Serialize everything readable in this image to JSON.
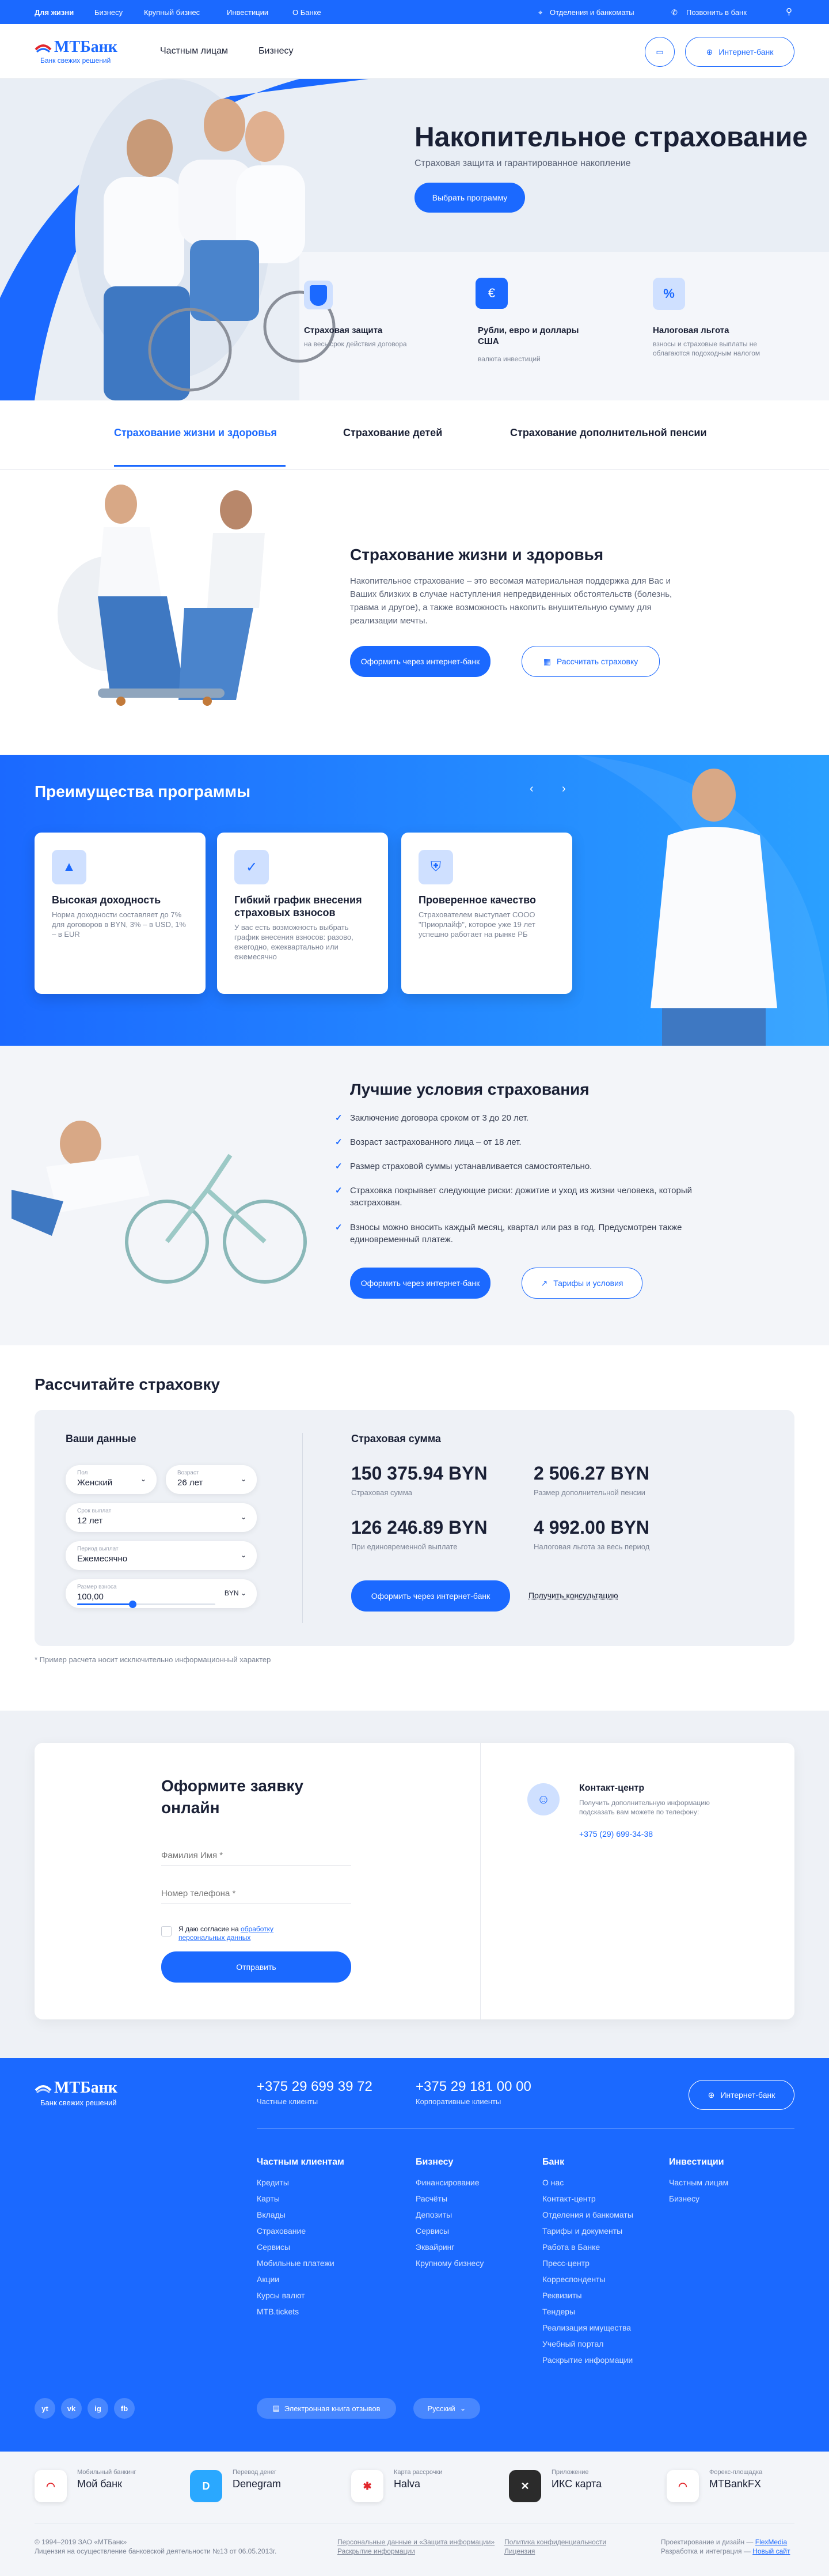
{
  "topbar": {
    "nav": [
      "Для жизни",
      "Бизнесу",
      "Крупный бизнес",
      "Инвестиции",
      "О Банке"
    ],
    "branches": "Отделения и банкоматы",
    "call": "Позвонить в банк"
  },
  "header": {
    "logo_name": "МТБанк",
    "logo_tagline": "Банк свежих решений",
    "nav": [
      "Частным лицам",
      "Бизнесу"
    ],
    "internet_bank": "Интернет-банк"
  },
  "hero": {
    "title": "Накопительное страхование",
    "subtitle": "Страховая защита и гарантированное накопление",
    "cta": "Выбрать программу",
    "features": [
      {
        "title": "Страховая защита",
        "desc": "на весь срок действия договора"
      },
      {
        "title": "Рубли, евро и доллары США",
        "desc": "валюта инвестиций"
      },
      {
        "title": "Налоговая льгота",
        "desc": "взносы и страховые выплаты не облагаются подоходным налогом"
      }
    ]
  },
  "tabs": [
    "Страхование жизни и здоровья",
    "Страхование детей",
    "Страхование дополнительной пенсии"
  ],
  "life": {
    "title": "Страхование жизни и здоровья",
    "text": "Накопительное страхование – это весомая материальная поддержка для Вас и Ваших близких в случае наступления непредвиденных обстоятельств (болезнь, травма и другое), а также возможность накопить внушительную сумму для реализации мечты.",
    "cta_primary": "Оформить через интернет-банк",
    "cta_secondary": "Рассчитать страховку"
  },
  "benefits": {
    "title": "Преимущества программы",
    "cards": [
      {
        "title": "Высокая доходность",
        "desc": "Норма доходности составляет до 7% для договоров в BYN, 3% – в USD, 1% – в EUR"
      },
      {
        "title": "Гибкий график внесения страховых взносов",
        "desc": "У вас есть возможность выбрать график внесения взносов: разово, ежегодно, ежеквартально или ежемесячно"
      },
      {
        "title": "Проверенное качество",
        "desc": "Страхователем выступает СООО \"Приорлайф\", которое уже 19 лет успешно работает на рынке РБ"
      }
    ]
  },
  "conditions": {
    "title": "Лучшие условия страхования",
    "items": [
      "Заключение договора сроком от 3 до 20 лет.",
      "Возраст застрахованного лица – от 18 лет.",
      "Размер страховой суммы устанавливается самостоятельно.",
      "Страховка покрывает следующие риски: дожитие и уход из жизни человека, который застрахован.",
      "Взносы можно вносить каждый месяц, квартал или раз в год. Предусмотрен также единовременный платеж."
    ],
    "cta_primary": "Оформить через интернет-банк",
    "cta_secondary": "Тарифы и условия"
  },
  "calculator": {
    "title": "Рассчитайте страховку",
    "your_data": "Ваши данные",
    "gender_label": "Пол",
    "gender_value": "Женский",
    "age_label": "Возраст",
    "age_value": "26 лет",
    "term_label": "Срок выплат",
    "term_value": "12 лет",
    "period_label": "Период выплат",
    "period_value": "Ежемесячно",
    "amount_label": "Размер взноса",
    "amount_value": "100,00",
    "currency": "BYN",
    "slider_fraction": 0.4,
    "result_title": "Страховая сумма",
    "results": [
      {
        "value": "150 375.94 BYN",
        "label": "Страховая сумма"
      },
      {
        "value": "2 506.27 BYN",
        "label": "Размер дополнительной пенсии"
      },
      {
        "value": "126 246.89 BYN",
        "label": "При единовременной выплате"
      },
      {
        "value": "4 992.00 BYN",
        "label": "Налоговая льгота за весь период"
      }
    ],
    "cta_primary": "Оформить через интернет-банк",
    "cta_secondary": "Получить консультацию",
    "note": "* Пример расчета носит исключительно информационный характер"
  },
  "application": {
    "title": "Оформите заявку онлайн",
    "name_placeholder": "Фамилия Имя *",
    "phone_placeholder": "Номер телефона *",
    "consent_text": "Я даю согласие на",
    "consent_link": "обработку персональных данных",
    "submit": "Отправить",
    "contact_title": "Контакт-центр",
    "contact_desc": "Получить дополнительную информацию подсказать вам можете по телефону:",
    "contact_phone": "+375 (29) 699-34-38"
  },
  "footer": {
    "phone1": "+375 29 699 39 72",
    "phone1_label": "Частные клиенты",
    "phone2": "+375 29 181 00 00",
    "phone2_label": "Корпоративные клиенты",
    "internet_bank": "Интернет-банк",
    "columns": [
      {
        "title": "Частным клиентам",
        "links": [
          "Кредиты",
          "Карты",
          "Вклады",
          "Страхование",
          "Сервисы",
          "Мобильные платежи",
          "Акции",
          "Курсы валют",
          "MTB.tickets"
        ]
      },
      {
        "title": "Бизнесу",
        "links": [
          "Финансирование",
          "Расчёты",
          "Депозиты",
          "Сервисы",
          "Эквайринг",
          "Крупному бизнесу"
        ]
      },
      {
        "title": "Банк",
        "links": [
          "О нас",
          "Контакт-центр",
          "Отделения и банкоматы",
          "Тарифы и документы",
          "Работа в Банке",
          "Пресс-центр",
          "Корреспонденты",
          "Реквизиты",
          "Тендеры",
          "Реализация имущества",
          "Учебный портал",
          "Раскрытие информации"
        ]
      },
      {
        "title": "Инвестиции",
        "links": [
          "Частным лицам",
          "Бизнесу"
        ]
      }
    ],
    "socials": [
      "yt",
      "vk",
      "ig",
      "fb"
    ],
    "feedback": "Электронная книга отзывов",
    "language": "Русский"
  },
  "apps": [
    {
      "sub": "Мобильный банкинг",
      "name": "Мой банк",
      "color": "#ffffff"
    },
    {
      "sub": "Перевод денег",
      "name": "Denegram",
      "color": "#2aa8ff"
    },
    {
      "sub": "Карта рассрочки",
      "name": "Halva",
      "color": "#ffffff"
    },
    {
      "sub": "Приложение",
      "name": "ИКС карта",
      "color": "#2b2b2b"
    },
    {
      "sub": "Форекс-площадка",
      "name": "MTBankFX",
      "color": "#ffffff"
    }
  ],
  "legal": {
    "copyright": "© 1994–2019 ЗАО «МТБанк»",
    "license": "Лицензия на осуществление банковской деятельности №13 от 06.05.2013г.",
    "link1": "Персональные данные и «Защита информации»",
    "link2": "Раскрытие информации",
    "link3": "Политика конфиденциальности",
    "link4": "Лицензия",
    "design": "Проектирование и дизайн —",
    "design_link": "FlexMedia",
    "dev": "Разработка и интеграция —",
    "dev_link": "Новый сайт"
  }
}
